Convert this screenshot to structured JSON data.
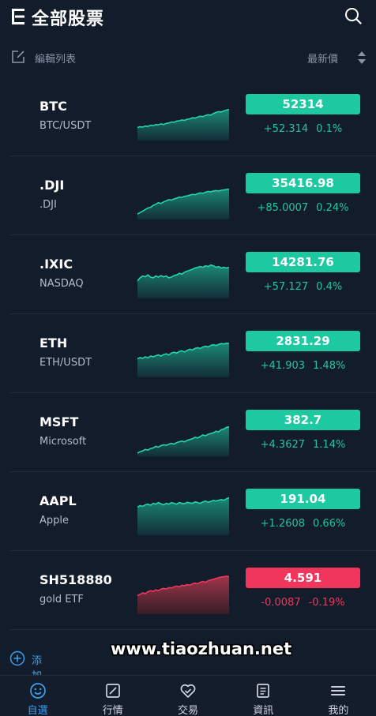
{
  "header": {
    "title": "全部股票"
  },
  "toolbar": {
    "edit_label": "編輯列表",
    "sort_label": "最新價"
  },
  "colors": {
    "up": "#1cc9a1",
    "down": "#f0365d",
    "up_text": "#1fc79e",
    "down_text": "#f0365d",
    "accent": "#3aa0f0"
  },
  "stocks": [
    {
      "symbol": "BTC",
      "name": "BTC/USDT",
      "price": "52314",
      "change": "+52.314",
      "percent": "0.1%",
      "direction": "up",
      "trend": [
        0.3,
        0.32,
        0.31,
        0.34,
        0.33,
        0.36,
        0.35,
        0.38,
        0.37,
        0.4,
        0.38,
        0.41,
        0.42,
        0.45,
        0.44,
        0.47,
        0.48,
        0.5,
        0.49,
        0.52,
        0.53,
        0.56,
        0.55,
        0.58,
        0.6,
        0.59,
        0.62,
        0.64,
        0.63,
        0.67,
        0.7,
        0.72,
        0.71,
        0.74,
        0.76,
        0.78
      ]
    },
    {
      "symbol": ".DJI",
      "name": ".DJI",
      "price": "35416.98",
      "change": "+85.0007",
      "percent": "0.24%",
      "direction": "up",
      "trend": [
        0.1,
        0.14,
        0.18,
        0.22,
        0.26,
        0.28,
        0.33,
        0.36,
        0.4,
        0.38,
        0.42,
        0.45,
        0.48,
        0.47,
        0.5,
        0.52,
        0.55,
        0.54,
        0.57,
        0.58,
        0.6,
        0.62,
        0.61,
        0.64,
        0.66,
        0.65,
        0.68,
        0.7,
        0.69,
        0.71,
        0.72,
        0.71,
        0.73,
        0.74,
        0.75,
        0.76
      ]
    },
    {
      "symbol": ".IXIC",
      "name": "NASDAQ",
      "price": "14281.76",
      "change": "+57.127",
      "percent": "0.4%",
      "direction": "up",
      "trend": [
        0.42,
        0.5,
        0.55,
        0.53,
        0.58,
        0.52,
        0.5,
        0.55,
        0.52,
        0.56,
        0.53,
        0.55,
        0.5,
        0.52,
        0.56,
        0.58,
        0.62,
        0.6,
        0.65,
        0.68,
        0.7,
        0.73,
        0.76,
        0.78,
        0.8,
        0.78,
        0.82,
        0.8,
        0.84,
        0.82,
        0.78,
        0.8,
        0.76,
        0.78,
        0.76,
        0.78
      ]
    },
    {
      "symbol": "ETH",
      "name": "ETH/USDT",
      "price": "2831.29",
      "change": "+41.903",
      "percent": "1.48%",
      "direction": "up",
      "trend": [
        0.45,
        0.48,
        0.46,
        0.5,
        0.47,
        0.52,
        0.5,
        0.53,
        0.55,
        0.52,
        0.56,
        0.58,
        0.55,
        0.6,
        0.62,
        0.6,
        0.64,
        0.66,
        0.63,
        0.67,
        0.7,
        0.68,
        0.72,
        0.74,
        0.72,
        0.76,
        0.78,
        0.76,
        0.8,
        0.82,
        0.8,
        0.83,
        0.85,
        0.84,
        0.86,
        0.85
      ]
    },
    {
      "symbol": "MSFT",
      "name": "Microsoft",
      "price": "382.7",
      "change": "+4.3627",
      "percent": "1.14%",
      "direction": "up",
      "trend": [
        0.04,
        0.08,
        0.1,
        0.14,
        0.12,
        0.16,
        0.18,
        0.22,
        0.2,
        0.24,
        0.26,
        0.25,
        0.28,
        0.3,
        0.28,
        0.32,
        0.34,
        0.36,
        0.34,
        0.38,
        0.4,
        0.42,
        0.46,
        0.44,
        0.48,
        0.52,
        0.5,
        0.54,
        0.56,
        0.58,
        0.62,
        0.6,
        0.66,
        0.68,
        0.72,
        0.74
      ]
    },
    {
      "symbol": "AAPL",
      "name": "Apple",
      "price": "191.04",
      "change": "+1.2608",
      "percent": "0.66%",
      "direction": "up",
      "trend": [
        0.7,
        0.74,
        0.72,
        0.76,
        0.78,
        0.75,
        0.8,
        0.78,
        0.82,
        0.79,
        0.76,
        0.8,
        0.78,
        0.82,
        0.8,
        0.78,
        0.82,
        0.8,
        0.79,
        0.83,
        0.81,
        0.8,
        0.84,
        0.82,
        0.8,
        0.84,
        0.86,
        0.83,
        0.85,
        0.88,
        0.86,
        0.88,
        0.9,
        0.88,
        0.92,
        0.95
      ]
    },
    {
      "symbol": "SH518880",
      "name": "gold ETF",
      "price": "4.591",
      "change": "-0.0087",
      "percent": "-0.19%",
      "direction": "down",
      "trend": [
        0.45,
        0.48,
        0.52,
        0.5,
        0.55,
        0.58,
        0.56,
        0.6,
        0.58,
        0.62,
        0.64,
        0.62,
        0.66,
        0.65,
        0.68,
        0.7,
        0.68,
        0.72,
        0.71,
        0.74,
        0.72,
        0.76,
        0.78,
        0.76,
        0.8,
        0.82,
        0.8,
        0.84,
        0.86,
        0.88,
        0.9,
        0.92,
        0.94,
        0.95,
        0.96,
        0.95
      ]
    }
  ],
  "add_label": "添加股票",
  "watermark": "www.tiaozhuan.net",
  "tabs": [
    {
      "label": "自選",
      "icon": "smiley-icon",
      "active": true
    },
    {
      "label": "行情",
      "icon": "chart-edit-icon",
      "active": false
    },
    {
      "label": "交易",
      "icon": "heart-exchange-icon",
      "active": false
    },
    {
      "label": "資訊",
      "icon": "news-icon",
      "active": false
    },
    {
      "label": "我的",
      "icon": "menu-icon",
      "active": false
    }
  ]
}
